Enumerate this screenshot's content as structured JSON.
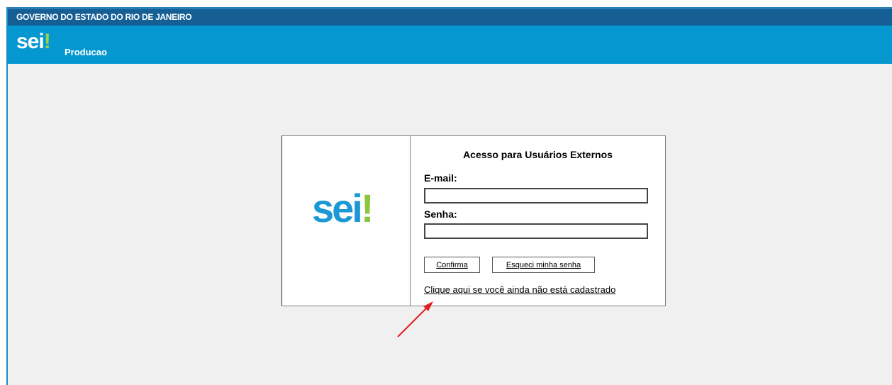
{
  "header": {
    "gov_title": "GOVERNO DO ESTADO DO RIO DE JANEIRO",
    "logo_text": "sei",
    "logo_mark": "!",
    "system_name": "Producao"
  },
  "login": {
    "logo_text": "sei",
    "logo_mark": "!",
    "title": "Acesso para Usuários Externos",
    "email_label": "E-mail:",
    "email_value": "",
    "password_label": "Senha:",
    "password_value": "",
    "confirm_button": "Confirma",
    "forgot_button": "Esqueci minha senha",
    "register_link": "Clique aqui se você ainda não está cadastrado"
  },
  "colors": {
    "gov_bar": "#155f95",
    "system_bar": "#0597cf",
    "logo_blue": "#1b98d5",
    "logo_green": "#8cc63f",
    "annotation_arrow": "#e02020"
  },
  "icons": {
    "annotation": "red-arrow-icon"
  }
}
